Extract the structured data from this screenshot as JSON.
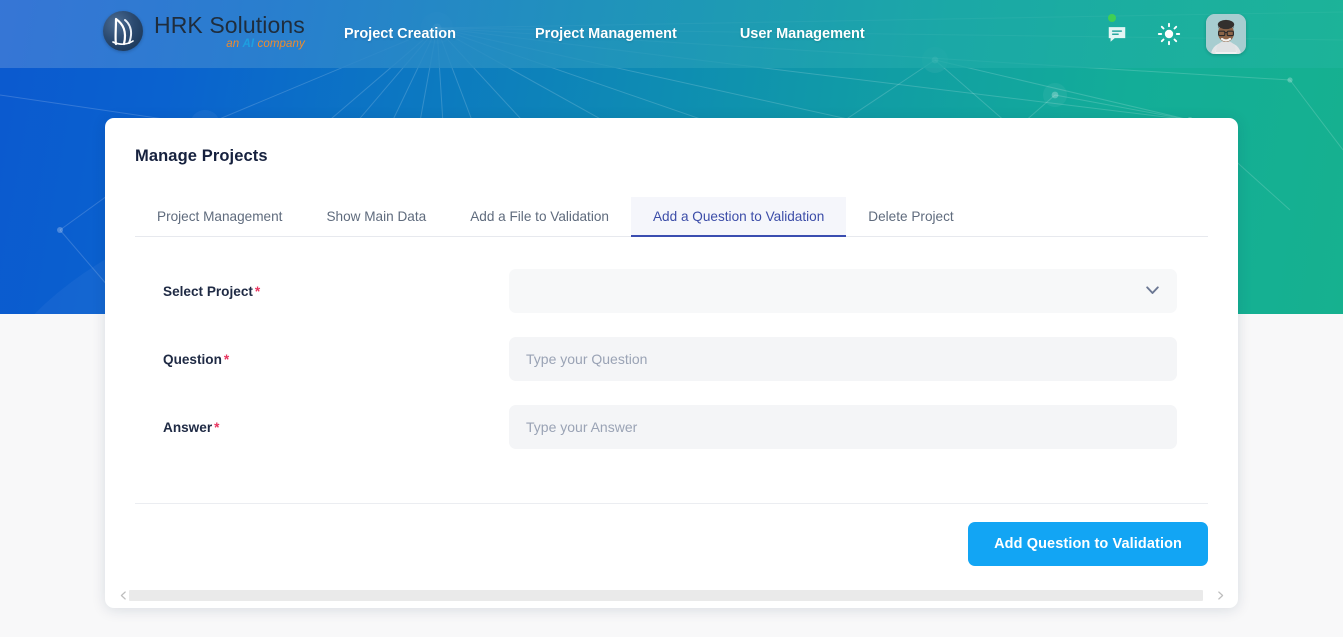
{
  "header": {
    "logo": {
      "mark_icon": "hrk-monogram-icon",
      "title": "HRK Solutions",
      "tagline_part1": "an ",
      "tagline_part2": "AI",
      "tagline_part3": " company"
    },
    "nav": [
      {
        "label": "Project Creation",
        "name": "nav-project-creation"
      },
      {
        "label": "Project Management",
        "name": "nav-project-management"
      },
      {
        "label": "User Management",
        "name": "nav-user-management"
      }
    ],
    "actions": {
      "messages_icon": "chat-message-icon",
      "messages_has_notification": true,
      "theme_icon": "sun-icon",
      "avatar_icon": "user-avatar"
    }
  },
  "card": {
    "title": "Manage Projects",
    "tabs": [
      {
        "label": "Project Management",
        "active": false
      },
      {
        "label": "Show Main Data",
        "active": false
      },
      {
        "label": "Add a File to Validation",
        "active": false
      },
      {
        "label": "Add a Question to Validation",
        "active": true
      },
      {
        "label": "Delete Project",
        "active": false
      }
    ],
    "form": {
      "fields": [
        {
          "label": "Select Project",
          "required": true,
          "type": "select",
          "value": "",
          "placeholder": "",
          "icon": "chevron-down-icon"
        },
        {
          "label": "Question",
          "required": true,
          "type": "text",
          "value": "",
          "placeholder": "Type your Question"
        },
        {
          "label": "Answer",
          "required": true,
          "type": "text",
          "value": "",
          "placeholder": "Type your Answer"
        }
      ],
      "required_marker": "*"
    },
    "submit_button": "Add Question to Validation",
    "scrollbar": {
      "left_arrow_icon": "scroll-left-arrow-icon",
      "right_arrow_icon": "scroll-right-arrow-icon"
    }
  },
  "colors": {
    "accent_blue": "#12a5f4",
    "tab_active": "#3a4db0",
    "required_red": "#e8355f",
    "notification_green": "#3fcf55",
    "banner_start": "#0b59cf",
    "banner_end": "#16b18f"
  }
}
